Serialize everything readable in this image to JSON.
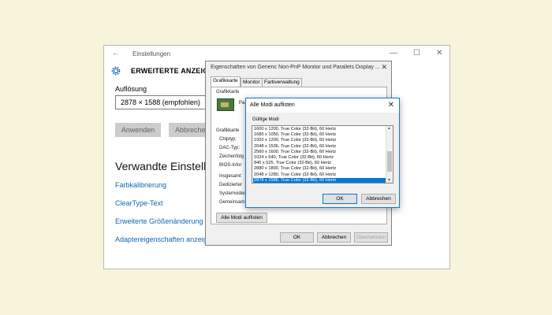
{
  "settings": {
    "title": "Einstellungen",
    "back": "←",
    "controls": [
      "—",
      "☐",
      "✕"
    ],
    "header": "ERWEITERTE ANZEIGEEI",
    "resolution_label": "Auflösung",
    "resolution_value": "2878 × 1588 (empfohlen)",
    "apply_button": "Anwenden",
    "cancel_button": "Abbreche",
    "related_title": "Verwandte Einstellu",
    "links": [
      "Farbkalibrierung",
      "ClearType-Text",
      "Erweiterte Größenänderung fü",
      "Adaptereigenschaften anzeige"
    ]
  },
  "properties": {
    "title": "Eigenschaften von Generic Non-PnP Monitor und Parallels Display ...",
    "close": "✕",
    "tabs": [
      "Grafikkarte",
      "Monitor",
      "Farbverwaltung"
    ],
    "group_adapter": "Grafikkarte",
    "adapter_name": "Pa",
    "group_info": "Grafikkarte",
    "info_labels": [
      "Chiptyp:",
      "DAC-Typ:",
      "Zeichenfolg",
      "BIOS-Infor"
    ],
    "memory_labels": [
      "Insgesamt",
      "Dedizierter",
      "Systemvideo",
      "Gemeinsam"
    ],
    "list_modes_button": "Alle Modi auflisten",
    "ok_button": "OK",
    "cancel_button": "Abbrechen",
    "apply_button": "Übernehmen"
  },
  "modes": {
    "title": "Alle Modi auflisten",
    "close": "✕",
    "valid_label": "Gültige Modi",
    "items": [
      "1600 x 1200, True Color (32-Bit), 60 Hertz",
      "1680 x 1050, True Color (32-Bit), 60 Hertz",
      "1920 x 1200, True Color (32-Bit), 60 Hertz",
      "2048 x 1536, True Color (32-Bit), 60 Hertz",
      "2560 x 1600, True Color (32-Bit), 60 Hertz",
      "1024 x 640, True Color (32-Bit), 60 Hertz",
      "840 x 525, True Color (32-Bit), 60 Hertz",
      "2880 x 1800, True Color (32-Bit), 60 Hertz",
      "2048 x 1280, True Color (32-Bit), 60 Hertz",
      "2878 x 1588, True Color (32-Bit), 60 Hertz"
    ],
    "selected_index": 9,
    "ok_button": "OK",
    "cancel_button": "Abbrechen"
  },
  "colors": {
    "background": "#f8f4dc",
    "link": "#1065b5",
    "accent": "#0078d7"
  }
}
